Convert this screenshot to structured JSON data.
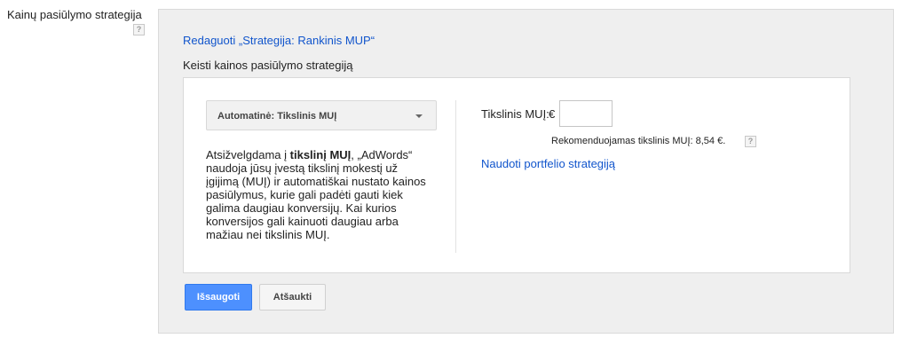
{
  "field": {
    "label": "Kainų pasiūlymo strategija",
    "help": "?"
  },
  "panel": {
    "edit_link": "Redaguoti „Strategija: Rankinis MUP“",
    "subtitle": "Keisti kainos pasiūlymo strategiją",
    "strategy_select": {
      "selected": "Automatinė: Tikslinis MUĮ"
    },
    "description": {
      "part1": "Atsižvelgdama į ",
      "bold": "tikslinį MUĮ",
      "part2": ", „AdWords“ naudoja jūsų įvestą tikslinį mokestį už įgijimą (MUĮ) ir automatiškai nustato kainos pasiūlymus, kurie gali padėti gauti kiek galima daugiau konversijų. Kai kurios konversijos gali kainuoti daugiau arba mažiau nei tikslinis MUĮ."
    },
    "target_cpa": {
      "label": "Tikslinis MUĮ:",
      "currency": "€",
      "value": "",
      "recommendation": "Rekomenduojamas tikslinis MUĮ: 8,54 €.",
      "help": "?"
    },
    "portfolio_link": "Naudoti portfelio strategiją"
  },
  "buttons": {
    "save": "Išsaugoti",
    "cancel": "Atšaukti"
  },
  "colors": {
    "link": "#1155cc",
    "primary_button": "#4d90fe",
    "panel_bg": "#efefef"
  }
}
